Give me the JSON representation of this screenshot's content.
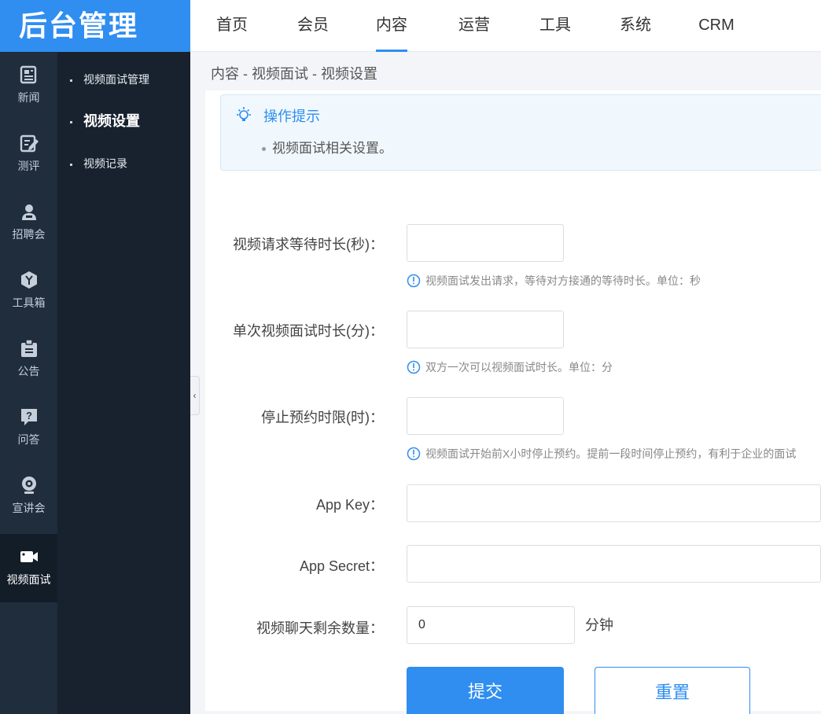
{
  "logo": {
    "text": "后台管理"
  },
  "topnav": {
    "tabs": [
      {
        "label": "首页"
      },
      {
        "label": "会员"
      },
      {
        "label": "内容",
        "active": true
      },
      {
        "label": "运营"
      },
      {
        "label": "工具"
      },
      {
        "label": "系统"
      },
      {
        "label": "CRM"
      }
    ]
  },
  "iconbar": {
    "items": [
      {
        "label": "新闻",
        "icon": "newspaper-icon"
      },
      {
        "label": "测评",
        "icon": "edit-icon"
      },
      {
        "label": "招聘会",
        "icon": "job-fair-icon"
      },
      {
        "label": "工具箱",
        "icon": "toolbox-icon"
      },
      {
        "label": "公告",
        "icon": "notice-icon"
      },
      {
        "label": "问答",
        "icon": "question-icon"
      },
      {
        "label": "宣讲会",
        "icon": "webcam-icon"
      },
      {
        "label": "视频面试",
        "icon": "video-camera-icon",
        "active": true
      }
    ]
  },
  "submenu": {
    "items": [
      {
        "label": "视频面试管理"
      },
      {
        "label": "视频设置",
        "active": true
      },
      {
        "label": "视频记录"
      }
    ]
  },
  "breadcrumb": "内容 - 视频面试 - 视频设置",
  "tip": {
    "title": "操作提示",
    "text": "视频面试相关设置。"
  },
  "form": {
    "wait_time": {
      "label": "视频请求等待时长(秒)：",
      "value": "",
      "hint": "视频面试发出请求，等待对方接通的等待时长。单位：秒"
    },
    "single_duration": {
      "label": "单次视频面试时长(分)：",
      "value": "",
      "hint": "双方一次可以视频面试时长。单位：分"
    },
    "stop_booking": {
      "label": "停止预约时限(时)：",
      "value": "",
      "hint": "视频面试开始前X小时停止预约。提前一段时间停止预约，有利于企业的面试"
    },
    "app_key": {
      "label": "App Key：",
      "value": ""
    },
    "app_secret": {
      "label": "App Secret：",
      "value": ""
    },
    "remaining": {
      "label": "视频聊天剩余数量：",
      "value": "0",
      "unit": "分钟"
    }
  },
  "buttons": {
    "submit": "提交",
    "reset": "重置"
  },
  "colors": {
    "accent": "#2f8ef0",
    "sidebar": "#1f2d3d",
    "submenu": "#18222e"
  }
}
